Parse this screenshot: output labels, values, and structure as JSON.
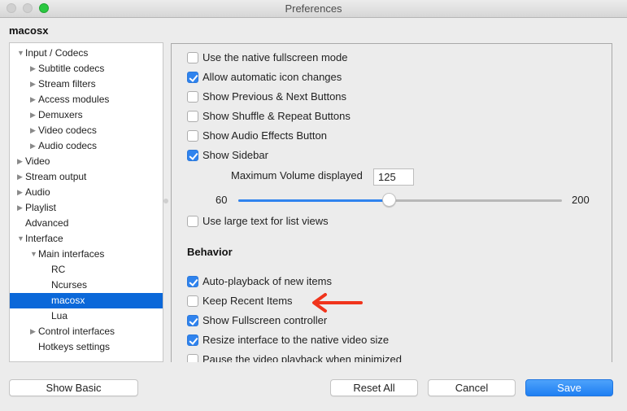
{
  "window": {
    "title": "Preferences",
    "section_title": "macosx"
  },
  "tree": {
    "items": [
      {
        "label": "Input / Codecs",
        "level": 0,
        "arrow": "expanded"
      },
      {
        "label": "Subtitle codecs",
        "level": 1,
        "arrow": "collapsed"
      },
      {
        "label": "Stream filters",
        "level": 1,
        "arrow": "collapsed"
      },
      {
        "label": "Access modules",
        "level": 1,
        "arrow": "collapsed"
      },
      {
        "label": "Demuxers",
        "level": 1,
        "arrow": "collapsed"
      },
      {
        "label": "Video codecs",
        "level": 1,
        "arrow": "collapsed"
      },
      {
        "label": "Audio codecs",
        "level": 1,
        "arrow": "collapsed"
      },
      {
        "label": "Video",
        "level": 0,
        "arrow": "collapsed"
      },
      {
        "label": "Stream output",
        "level": 0,
        "arrow": "collapsed"
      },
      {
        "label": "Audio",
        "level": 0,
        "arrow": "collapsed"
      },
      {
        "label": "Playlist",
        "level": 0,
        "arrow": "collapsed"
      },
      {
        "label": "Advanced",
        "level": 0,
        "arrow": "none"
      },
      {
        "label": "Interface",
        "level": 0,
        "arrow": "expanded"
      },
      {
        "label": "Main interfaces",
        "level": 1,
        "arrow": "expanded"
      },
      {
        "label": "RC",
        "level": 2,
        "arrow": "none"
      },
      {
        "label": "Ncurses",
        "level": 2,
        "arrow": "none"
      },
      {
        "label": "macosx",
        "level": 2,
        "arrow": "none",
        "selected": true
      },
      {
        "label": "Lua",
        "level": 2,
        "arrow": "none"
      },
      {
        "label": "Control interfaces",
        "level": 1,
        "arrow": "collapsed"
      },
      {
        "label": "Hotkeys settings",
        "level": 1,
        "arrow": "none"
      }
    ]
  },
  "appearance": {
    "options": [
      {
        "label": "Use the native fullscreen mode",
        "checked": false
      },
      {
        "label": "Allow automatic icon changes",
        "checked": true
      },
      {
        "label": "Show Previous & Next Buttons",
        "checked": false
      },
      {
        "label": "Show Shuffle & Repeat Buttons",
        "checked": false
      },
      {
        "label": "Show Audio Effects Button",
        "checked": false
      },
      {
        "label": "Show Sidebar",
        "checked": true
      }
    ],
    "max_volume_label": "Maximum Volume displayed",
    "max_volume_value": "125",
    "slider": {
      "min_label": "60",
      "max_label": "200",
      "min": 60,
      "max": 200,
      "value": 125
    },
    "large_text": {
      "label": "Use large text for list views",
      "checked": false
    }
  },
  "behavior": {
    "title": "Behavior",
    "options": [
      {
        "label": "Auto-playback of new items",
        "checked": true
      },
      {
        "label": "Keep Recent Items",
        "checked": false
      },
      {
        "label": "Show Fullscreen controller",
        "checked": true
      },
      {
        "label": "Resize interface to the native video size",
        "checked": true
      },
      {
        "label": "Pause the video playback when minimized",
        "checked": false
      }
    ]
  },
  "annotation": {
    "color": "#f0341c",
    "points_to": "Keep Recent Items"
  },
  "buttons": {
    "show_basic": "Show Basic",
    "reset_all": "Reset All",
    "cancel": "Cancel",
    "save": "Save"
  },
  "colors": {
    "accent": "#2f83ee",
    "selection": "#0b68d9",
    "window_bg": "#ececec"
  }
}
